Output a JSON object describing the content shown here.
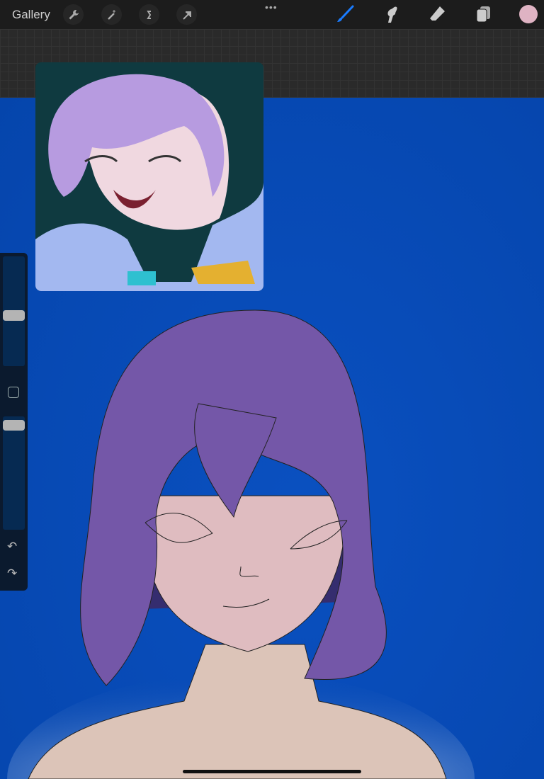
{
  "topbar": {
    "gallery_label": "Gallery",
    "more_label": "•••",
    "left_tools": [
      "wrench-icon",
      "magic-wand-icon",
      "selection-icon",
      "transform-arrow-icon"
    ],
    "right_tools": [
      "brush-icon",
      "smudge-icon",
      "eraser-icon",
      "layers-icon"
    ],
    "active_tool": "brush",
    "current_color": "#dfb3c3",
    "accent": "#1a7cff"
  },
  "sidebar": {
    "brush_size": 0.51,
    "opacity": 0.92,
    "undo": "↶",
    "redo": "↷"
  },
  "colors": {
    "background": "#0648b0",
    "hair": "#7457a8",
    "skin": "#e0bcc0"
  }
}
